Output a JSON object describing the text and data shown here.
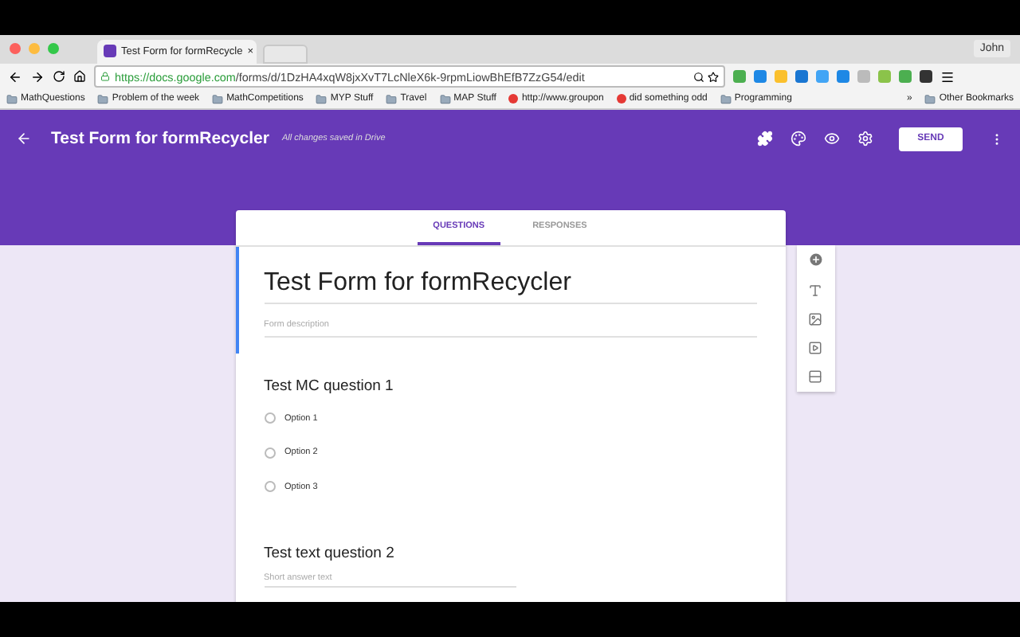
{
  "browser": {
    "tab_title": "Test Form for formRecycle",
    "tab_close": "×",
    "user": "John",
    "url_domain": "https://docs.google.com",
    "url_path": "/forms/d/1DzHA4xqW8jxXvT7LcNleX6k-9rpmLiowBhEfB7ZzG54/edit",
    "bookmarks": [
      {
        "label": "MathQuestions",
        "kind": "folder"
      },
      {
        "label": "Problem of the week",
        "kind": "folder"
      },
      {
        "label": "MathCompetitions",
        "kind": "folder"
      },
      {
        "label": "MYP Stuff",
        "kind": "folder"
      },
      {
        "label": "Travel",
        "kind": "folder"
      },
      {
        "label": "MAP Stuff",
        "kind": "folder"
      },
      {
        "label": "http://www.groupon",
        "kind": "site"
      },
      {
        "label": "did something odd",
        "kind": "site"
      },
      {
        "label": "Programming",
        "kind": "folder"
      }
    ],
    "overflow": "»",
    "other_bookmarks": "Other Bookmarks"
  },
  "header": {
    "title": "Test Form for formRecycler",
    "save_status": "All changes saved in Drive",
    "send_label": "SEND"
  },
  "tabs": [
    {
      "label": "QUESTIONS",
      "selected": true
    },
    {
      "label": "RESPONSES",
      "selected": false
    }
  ],
  "form": {
    "title": "Test Form for formRecycler",
    "description_placeholder": "Form description"
  },
  "questions": [
    {
      "kind": "choice",
      "title": "Test MC question 1",
      "options": [
        {
          "label": "Option 1",
          "checked": false
        },
        {
          "label": "Option 2",
          "checked": false
        },
        {
          "label": "Option 3",
          "checked": false
        }
      ]
    },
    {
      "kind": "text",
      "title": "Test text question 2",
      "placeholder": "Short answer text"
    }
  ]
}
